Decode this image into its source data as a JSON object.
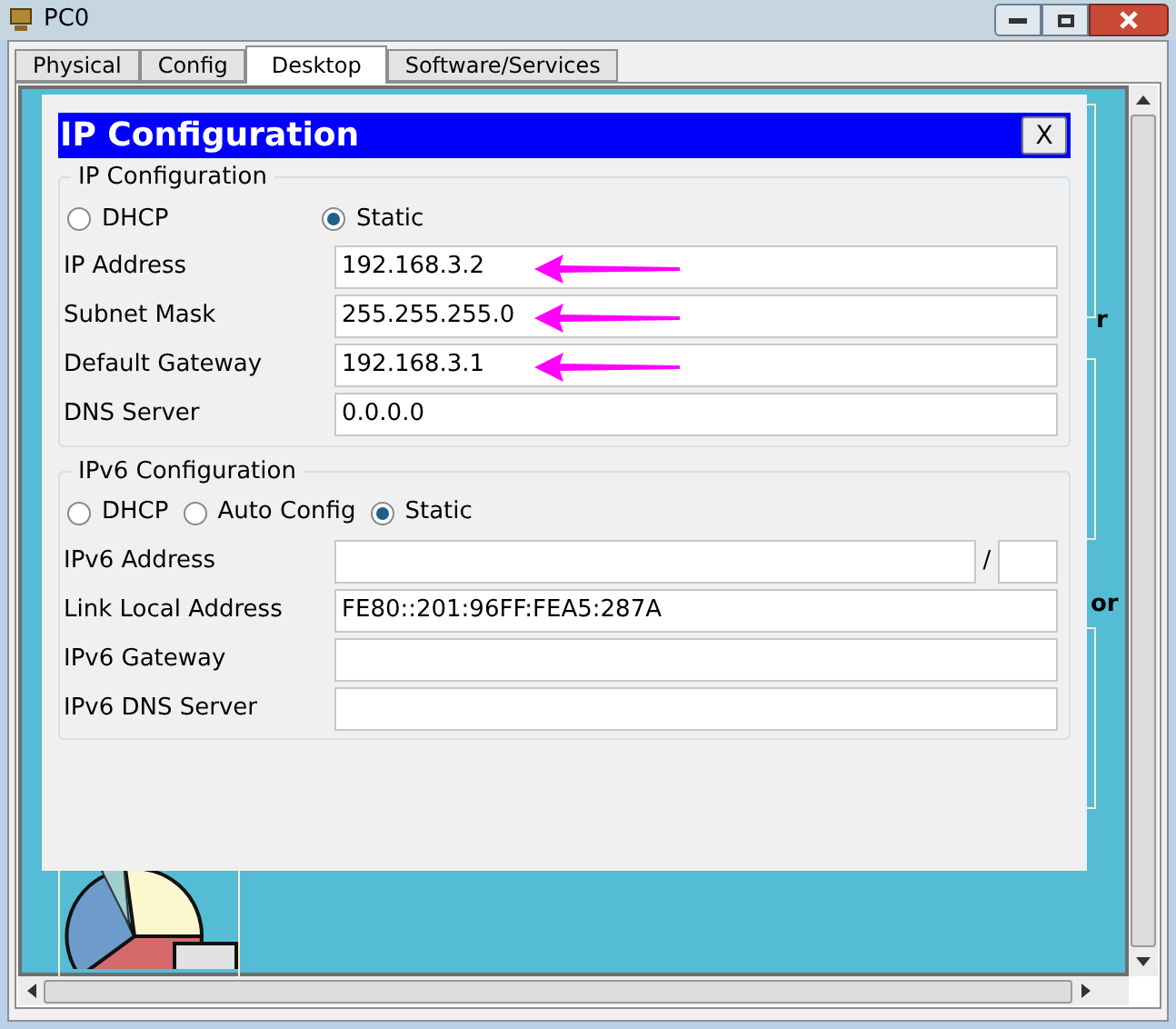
{
  "window": {
    "title": "PC0"
  },
  "tabs": [
    {
      "label": "Physical",
      "selected": false
    },
    {
      "label": "Config",
      "selected": false
    },
    {
      "label": "Desktop",
      "selected": true
    },
    {
      "label": "Software/Services",
      "selected": false
    }
  ],
  "background_fragments": [
    "r",
    "or"
  ],
  "dialog": {
    "title": "IP Configuration",
    "close": "X",
    "ipv4": {
      "legend": "IP Configuration",
      "modes": [
        {
          "label": "DHCP",
          "selected": false
        },
        {
          "label": "Static",
          "selected": true
        }
      ],
      "fields": [
        {
          "label": "IP Address",
          "value": "192.168.3.2",
          "annotated": true
        },
        {
          "label": "Subnet Mask",
          "value": "255.255.255.0",
          "annotated": true
        },
        {
          "label": "Default Gateway",
          "value": "192.168.3.1",
          "annotated": true
        },
        {
          "label": "DNS Server",
          "value": "0.0.0.0",
          "annotated": false
        }
      ]
    },
    "ipv6": {
      "legend": "IPv6 Configuration",
      "modes": [
        {
          "label": "DHCP",
          "selected": false
        },
        {
          "label": "Auto Config",
          "selected": false
        },
        {
          "label": "Static",
          "selected": true
        }
      ],
      "fields": [
        {
          "label": "IPv6 Address",
          "kind": "prefix",
          "separator": "/"
        },
        {
          "label": "Link Local Address",
          "kind": "plain",
          "value": "FE80::201:96FF:FEA5:287A"
        },
        {
          "label": "IPv6 Gateway",
          "kind": "plain"
        },
        {
          "label": "IPv6 DNS Server",
          "kind": "plain"
        }
      ]
    }
  }
}
